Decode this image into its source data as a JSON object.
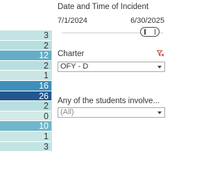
{
  "heatmap": {
    "cells": [
      {
        "value": "3",
        "color": "#c3e4e4"
      },
      {
        "value": "2",
        "color": "#b8dfe0"
      },
      {
        "value": "12",
        "color": "#63adc7"
      },
      {
        "value": "2",
        "color": "#b8dfe0"
      },
      {
        "value": "1",
        "color": "#c9e6e4"
      },
      {
        "value": "16",
        "color": "#3f8fba"
      },
      {
        "value": "26",
        "color": "#24568f"
      },
      {
        "value": "2",
        "color": "#b8dfe0"
      },
      {
        "value": "0",
        "color": "#d2eae7"
      },
      {
        "value": "10",
        "color": "#71b6ca"
      },
      {
        "value": "1",
        "color": "#c9e6e4"
      },
      {
        "value": "3",
        "color": "#c3e4e4"
      }
    ],
    "text_light": "#ffffff",
    "text_dark": "#333333"
  },
  "date_filter": {
    "title": "Date and Time of Incident",
    "start": "7/1/2024",
    "end": "6/30/2025"
  },
  "charter_filter": {
    "label": "Charter",
    "value": "OFY - D",
    "clear_icon": "filter-clear-icon",
    "icon_color": "#c0392b"
  },
  "students_filter": {
    "label": "Any of the students involve...",
    "value": "(All)"
  }
}
